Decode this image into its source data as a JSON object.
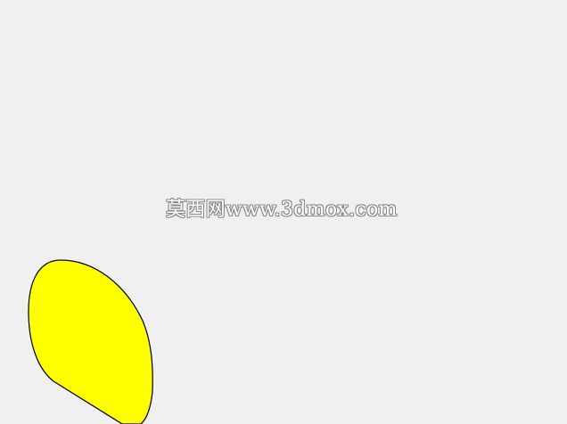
{
  "watermark": {
    "text": "莫西网www.3dmox.com"
  },
  "shape": {
    "icon": "yellow-ellipse-shape",
    "fill_color": "#ffff00",
    "stroke_color": "#000000"
  },
  "colors": {
    "background": "#f0f0f0"
  }
}
